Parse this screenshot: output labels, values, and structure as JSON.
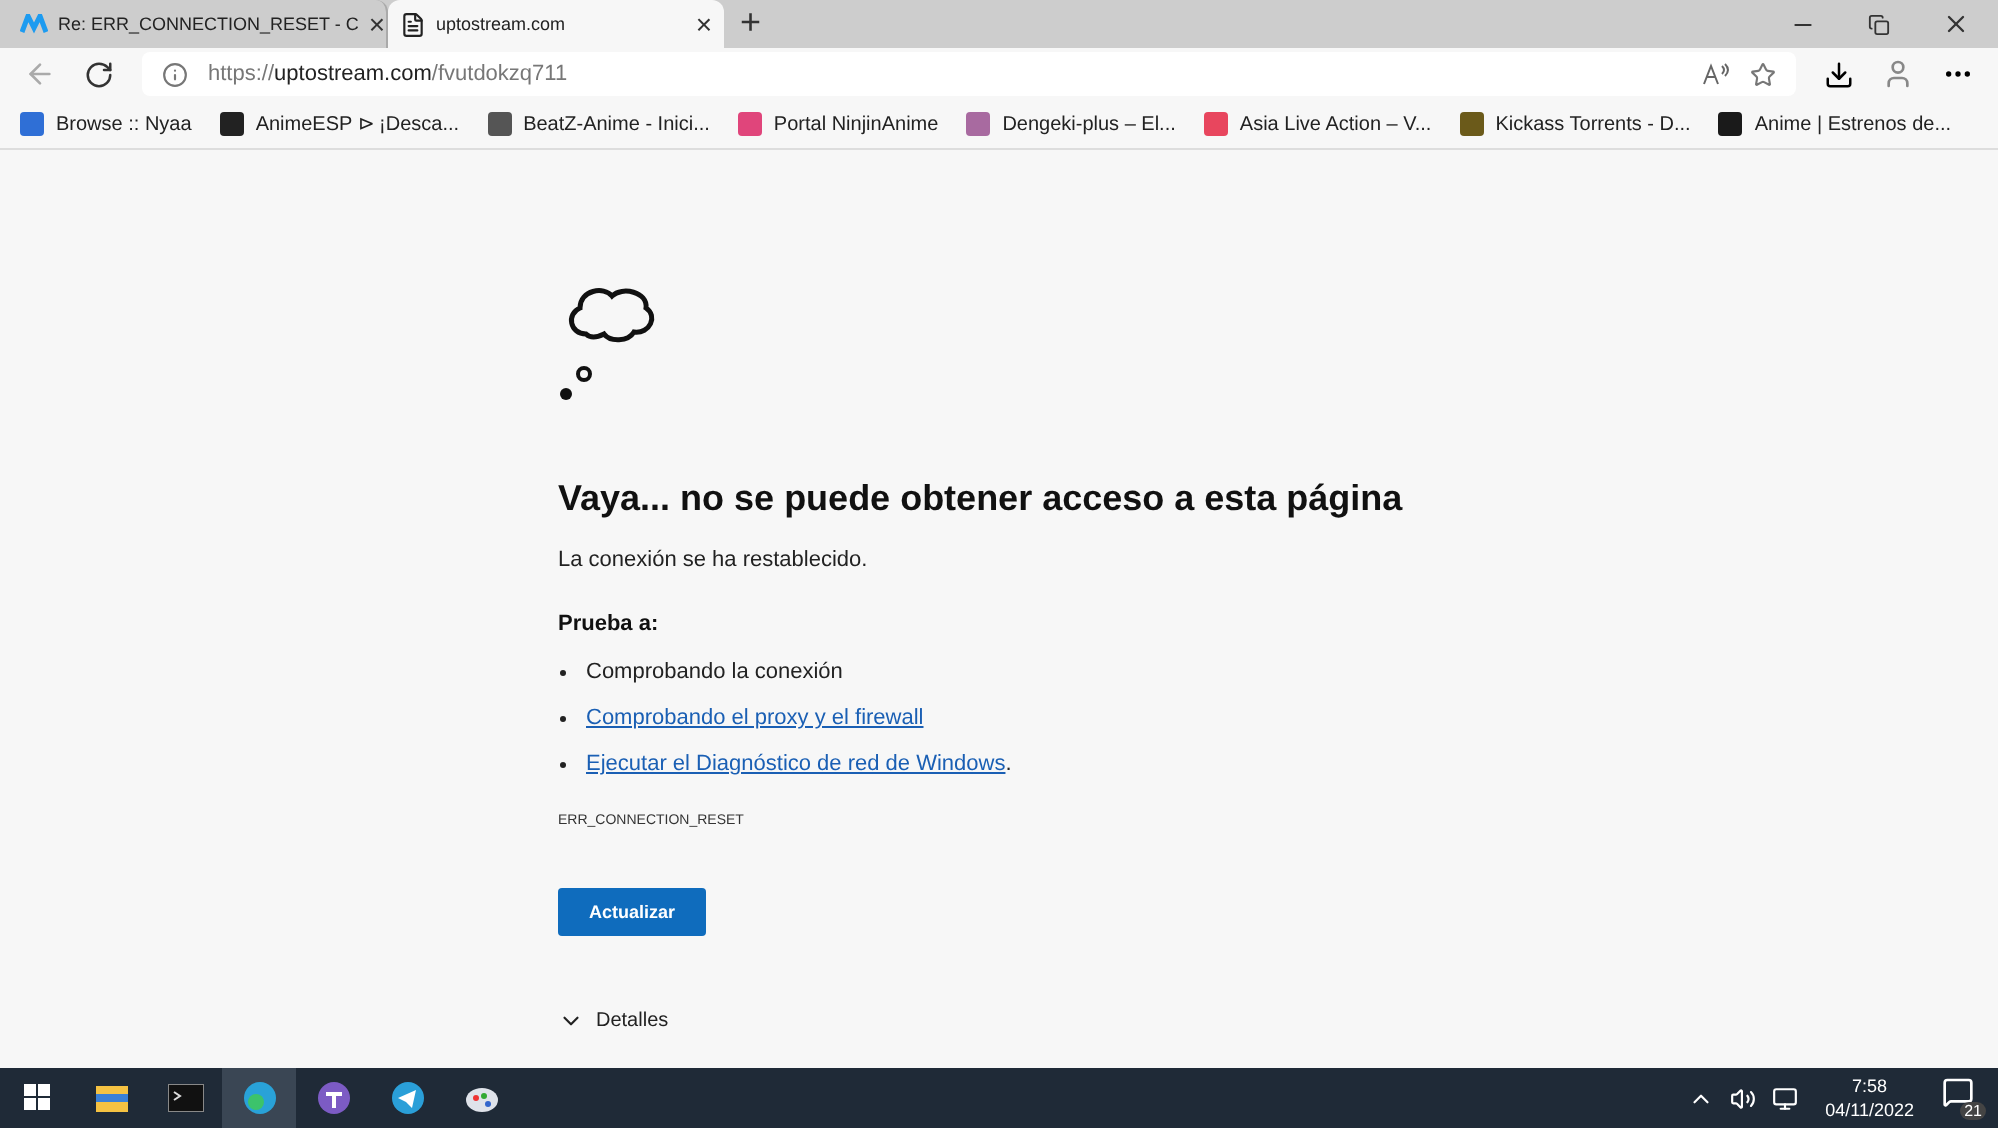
{
  "tabs": [
    {
      "title": "Re: ERR_CONNECTION_RESET - C",
      "selected": false,
      "close": "×"
    },
    {
      "title": "uptostream.com",
      "selected": true,
      "close": "×"
    }
  ],
  "new_tab": "+",
  "address": {
    "scheme": "https://",
    "host": "uptostream.com",
    "path": "/fvutdokzq711"
  },
  "bookmarks": [
    {
      "label": "Browse :: Nyaa",
      "color": "#2f6fd6"
    },
    {
      "label": "AnimeESP ⊳ ¡Desca...",
      "color": "#222222"
    },
    {
      "label": "BeatZ-Anime - Inici...",
      "color": "#555555"
    },
    {
      "label": "Portal NinjinAnime",
      "color": "#e0457b"
    },
    {
      "label": "Dengeki-plus – El...",
      "color": "#a86aa0"
    },
    {
      "label": "Asia Live Action – V...",
      "color": "#e8465e"
    },
    {
      "label": "Kickass Torrents - D...",
      "color": "#6b5a1a"
    },
    {
      "label": "Anime | Estrenos de...",
      "color": "#1a1a1a"
    }
  ],
  "error": {
    "title": "Vaya... no se puede obtener acceso a esta página",
    "message": "La conexión se ha restablecido.",
    "try_heading": "Prueba a:",
    "suggestions": [
      {
        "kind": "text",
        "text": "Comprobando la conexión"
      },
      {
        "kind": "link",
        "text": "Comprobando el proxy y el firewall"
      },
      {
        "kind": "link",
        "text": "Ejecutar el Diagnóstico de red de Windows",
        "suffix": "."
      }
    ],
    "code": "ERR_CONNECTION_RESET",
    "button": "Actualizar",
    "details": "Detalles",
    "details_expanded": false
  },
  "taskbar": {
    "apps": [
      {
        "kind": "folder",
        "selected": false
      },
      {
        "kind": "terminal",
        "selected": false
      },
      {
        "kind": "edge",
        "selected": true
      },
      {
        "kind": "torrent",
        "selected": false
      },
      {
        "kind": "telegram",
        "selected": false
      },
      {
        "kind": "paint",
        "selected": false
      }
    ],
    "time": "7:58",
    "date": "04/11/2022",
    "notifications": "21"
  }
}
